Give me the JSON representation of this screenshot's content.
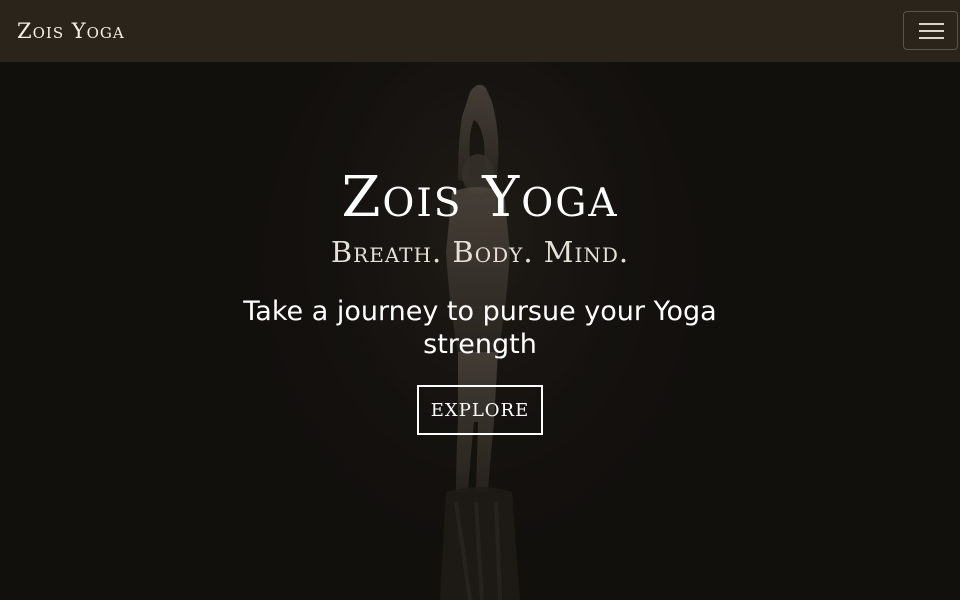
{
  "navbar": {
    "brand": "Zois Yoga",
    "menu_icon": "hamburger-menu-icon"
  },
  "hero": {
    "title": "Zois Yoga",
    "tagline": "Breath. Body. Mind.",
    "subtitle": "Take a journey to pursue your Yoga strength",
    "cta_label": "EXPLORE"
  },
  "colors": {
    "navbar_bg": "#2b241b",
    "hero_bg": "#161410",
    "text": "#ffffff"
  }
}
